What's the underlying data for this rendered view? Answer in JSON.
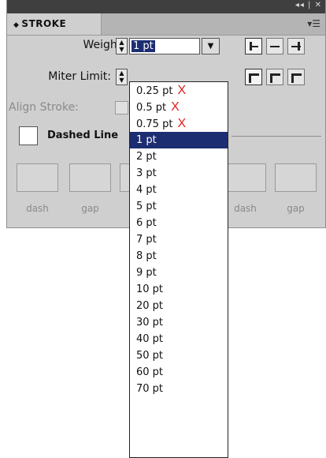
{
  "panel": {
    "title_controls": "◂◂ | ✕",
    "tab_label": "STROKE",
    "menu_icon": "panel-menu-icon"
  },
  "weight": {
    "label": "Weight:",
    "value": "1 pt"
  },
  "miter": {
    "label": "Miter Limit:"
  },
  "align_stroke": {
    "label": "Align Stroke:"
  },
  "dashed": {
    "label": "Dashed Line",
    "fields": [
      "dash",
      "gap",
      "dash",
      "gap",
      "dash",
      "gap"
    ]
  },
  "dropdown": {
    "items": [
      {
        "label": "0.25 pt",
        "mark": "X"
      },
      {
        "label": "0.5 pt",
        "mark": "X"
      },
      {
        "label": "0.75 pt",
        "mark": "X"
      },
      {
        "label": "1 pt",
        "mark": ""
      },
      {
        "label": "2 pt",
        "mark": ""
      },
      {
        "label": "3 pt",
        "mark": ""
      },
      {
        "label": "4 pt",
        "mark": ""
      },
      {
        "label": "5 pt",
        "mark": ""
      },
      {
        "label": "6 pt",
        "mark": ""
      },
      {
        "label": "7 pt",
        "mark": ""
      },
      {
        "label": "8 pt",
        "mark": ""
      },
      {
        "label": "9 pt",
        "mark": ""
      },
      {
        "label": "10 pt",
        "mark": ""
      },
      {
        "label": "20 pt",
        "mark": ""
      },
      {
        "label": "30 pt",
        "mark": ""
      },
      {
        "label": "40 pt",
        "mark": ""
      },
      {
        "label": "50 pt",
        "mark": ""
      },
      {
        "label": "60 pt",
        "mark": ""
      },
      {
        "label": "70 pt",
        "mark": ""
      }
    ],
    "selected": "1 pt"
  },
  "colors": {
    "selection": "#1d2d72",
    "annotation": "#e02020"
  }
}
